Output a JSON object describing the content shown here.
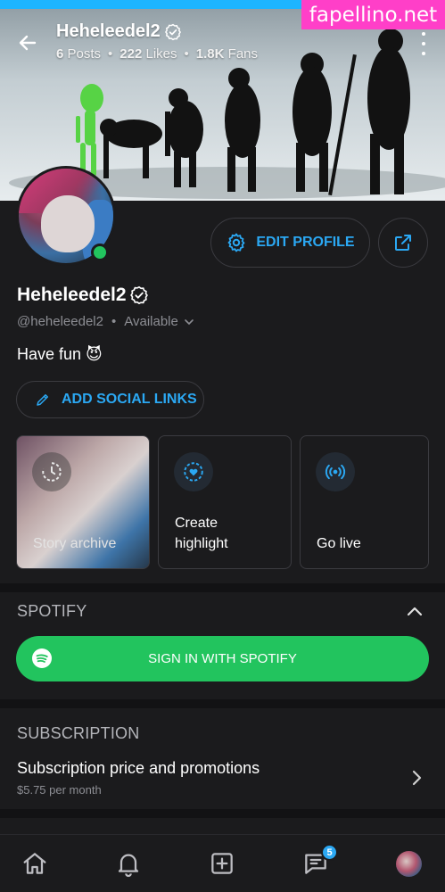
{
  "watermark": "fapellino.net",
  "header": {
    "name": "Heheleedel2",
    "posts_count": "6",
    "posts_label": "Posts",
    "likes_count": "222",
    "likes_label": "Likes",
    "fans_count": "1.8K",
    "fans_label": "Fans"
  },
  "profile": {
    "edit_label": "EDIT PROFILE",
    "display_name": "Heheleedel2",
    "handle": "@heheleedel2",
    "status": "Available",
    "bio": "Have fun 😈",
    "social_label": "ADD SOCIAL LINKS"
  },
  "cards": [
    {
      "label": "Story archive"
    },
    {
      "label": "Create highlight"
    },
    {
      "label": "Go live"
    }
  ],
  "spotify": {
    "section_title": "SPOTIFY",
    "button_label": "SIGN IN WITH SPOTIFY"
  },
  "subscription": {
    "section_title": "SUBSCRIPTION",
    "row_title": "Subscription price and promotions",
    "price": "$5.75 per month"
  },
  "nav": {
    "messages_badge": "5"
  },
  "colors": {
    "accent": "#2ba8f3",
    "online": "#22c45e",
    "spotify": "#22c45e",
    "background": "#1b1b1d"
  }
}
